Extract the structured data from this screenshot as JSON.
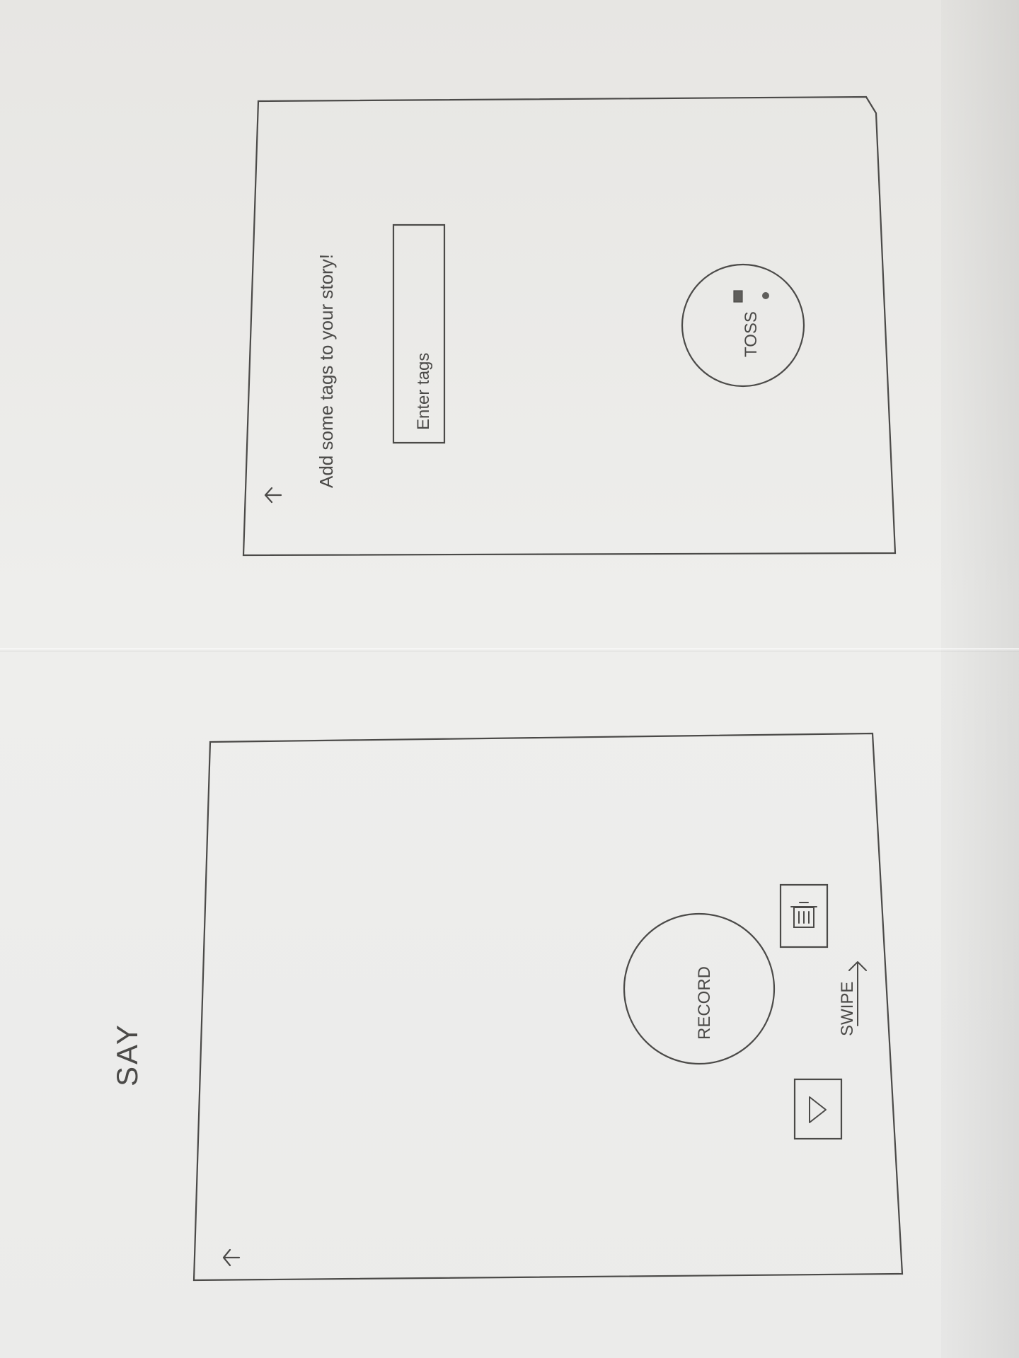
{
  "app": {
    "title": "SAY"
  },
  "screens": {
    "record_screen": {
      "back_label": "←",
      "record_button_label": "RECORD",
      "swipe_label": "SWIPE",
      "play_icon": "play-icon",
      "trash_icon": "trash-icon"
    },
    "tags_screen": {
      "back_label": "←",
      "heading": "Add some tags to your story!",
      "tags_input": {
        "value": "",
        "placeholder": "Enter tags"
      },
      "toss_button_label": "TOSS"
    }
  },
  "colors": {
    "paper": "#eeeeec",
    "ink": "#4b4a48",
    "shadow": "#d9d8d4"
  }
}
